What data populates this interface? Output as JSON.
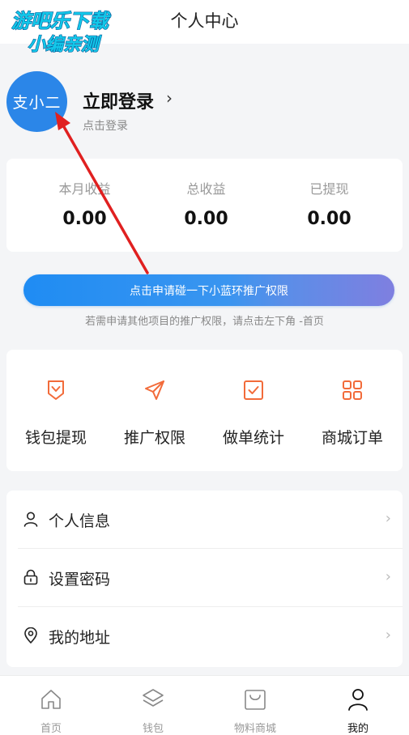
{
  "header": {
    "title": "个人中心"
  },
  "watermark": {
    "line1": "游吧乐下载",
    "line2": "小编亲测"
  },
  "profile": {
    "avatar_text": "支小二",
    "login_title": "立即登录",
    "chevron": "›",
    "login_sub": "点击登录"
  },
  "stats": [
    {
      "label": "本月收益",
      "value": "0.00"
    },
    {
      "label": "总收益",
      "value": "0.00"
    },
    {
      "label": "已提现",
      "value": "0.00"
    }
  ],
  "promo": {
    "button_label": "点击申请碰一下小蓝环推广权限",
    "tip": "若需申请其他项目的推广权限，请点击左下角 -首页"
  },
  "quick_actions": [
    {
      "label": "钱包提现",
      "icon": "wallet-withdraw-icon"
    },
    {
      "label": "推广权限",
      "icon": "paper-plane-icon"
    },
    {
      "label": "做单统计",
      "icon": "checkbox-icon"
    },
    {
      "label": "商城订单",
      "icon": "grid-icon"
    }
  ],
  "menu": [
    {
      "label": "个人信息",
      "icon": "user-icon",
      "chevron": "›"
    },
    {
      "label": "设置密码",
      "icon": "lock-icon",
      "chevron": "›"
    },
    {
      "label": "我的地址",
      "icon": "location-pin-icon",
      "chevron": "›"
    }
  ],
  "tabbar": [
    {
      "label": "首页",
      "icon": "home-icon",
      "active": false
    },
    {
      "label": "钱包",
      "icon": "layers-icon",
      "active": false
    },
    {
      "label": "物料商城",
      "icon": "shopping-bag-icon",
      "active": false
    },
    {
      "label": "我的",
      "icon": "person-icon",
      "active": true
    }
  ],
  "colors": {
    "accent_orange": "#f26b3a",
    "promo_blue": "#1f8cf3",
    "avatar_blue": "#2b86e8",
    "annotation_red": "#e02020",
    "watermark_cyan": "#10c8e8"
  }
}
